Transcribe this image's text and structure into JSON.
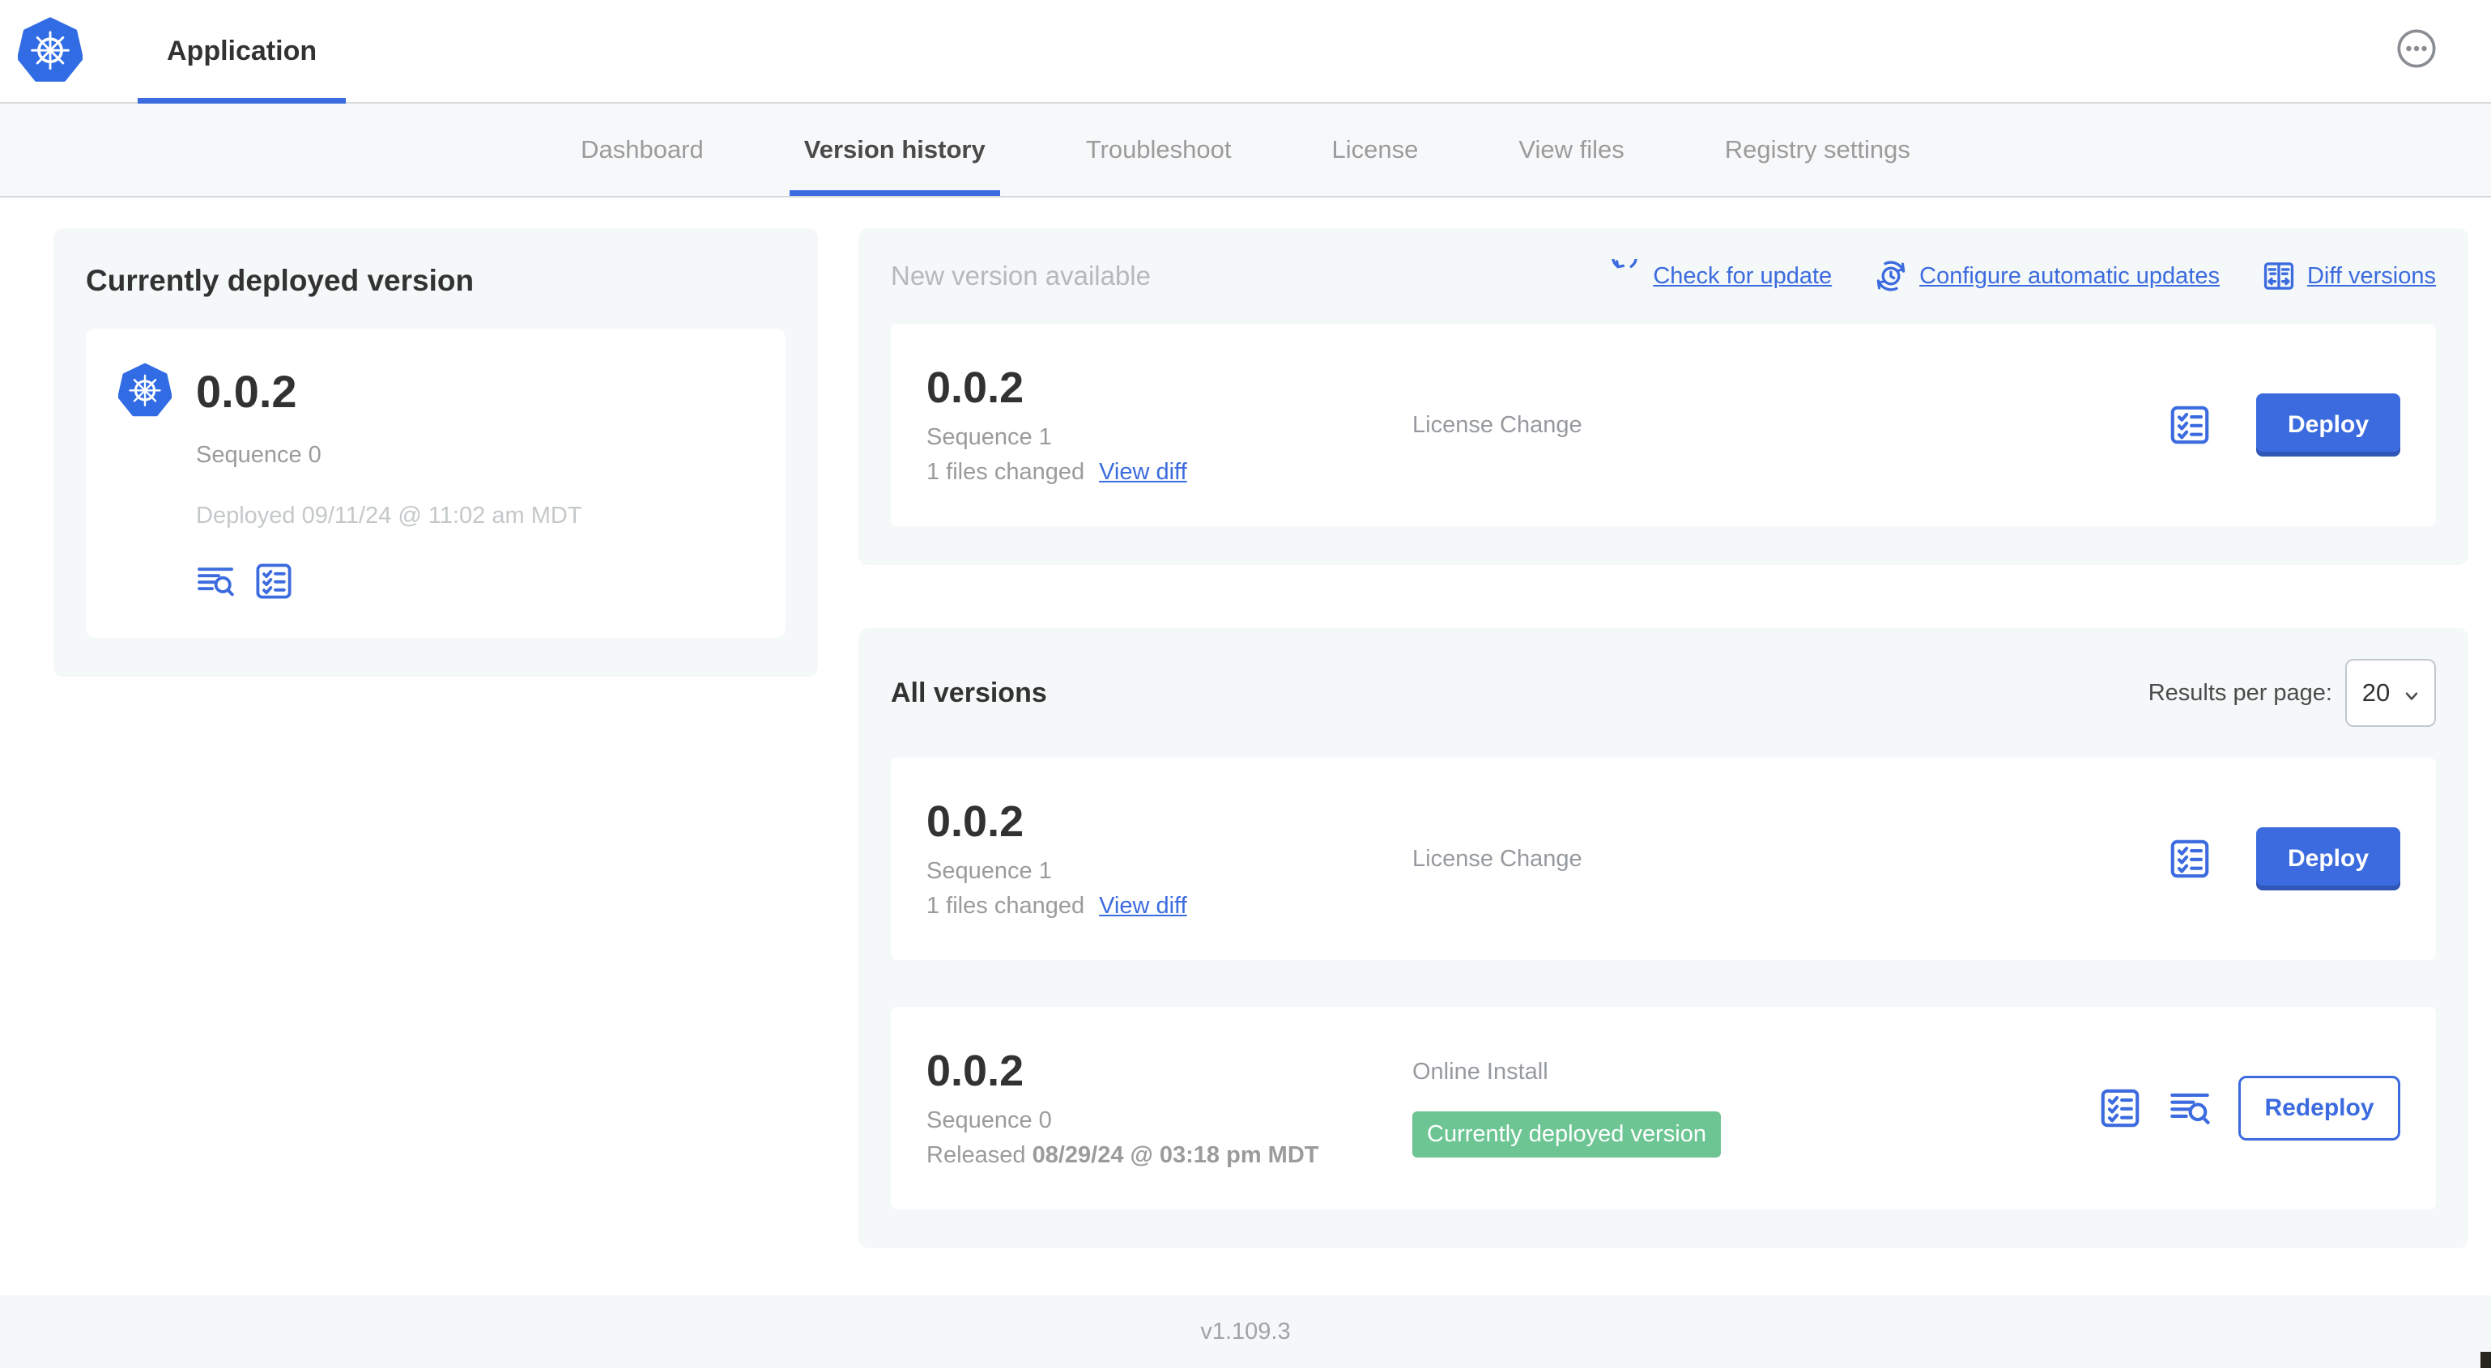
{
  "colors": {
    "accent_blue": "#3b6bde",
    "kubernetes_blue": "#326ce5",
    "badge_green": "#6dc594",
    "panel_gray": "#f5f8f9"
  },
  "header": {
    "app_title": "Application"
  },
  "nav": {
    "active_tab": "Version history",
    "tabs": [
      "Dashboard",
      "Version history",
      "Troubleshoot",
      "License",
      "View files",
      "Registry settings"
    ]
  },
  "deployed_card": {
    "title": "Currently deployed version",
    "version": "0.0.2",
    "sequence": "Sequence 0",
    "deployed_at": "Deployed 09/11/24 @ 11:02 am MDT"
  },
  "new_version_section": {
    "heading": "New version available",
    "check_for_update": "Check for update",
    "configure_automatic_updates": "Configure automatic updates",
    "diff_versions": "Diff versions"
  },
  "pending_version": {
    "version": "0.0.2",
    "sequence": "Sequence 1",
    "files_changed": "1 files changed",
    "view_diff": "View diff",
    "source": "License Change",
    "deploy_label": "Deploy"
  },
  "deployed_version": {
    "version": "0.0.2",
    "sequence": "Sequence 0",
    "released_prefix": "Released",
    "released_date": "08/29/24 @ 03:18 pm MDT",
    "source": "Online Install",
    "badge": "Currently deployed version",
    "redeploy_label": "Redeploy"
  },
  "all_versions_section": {
    "heading": "All versions",
    "results_per_page_label": "Results per page:",
    "results_per_page_value": "20"
  },
  "footer": {
    "version": "v1.109.3"
  },
  "icons": {
    "app_logo": "kubernetes-wheel",
    "menu": "ellipsis-in-circle",
    "check_for_update": "refresh-arrow",
    "configure_automatic_updates": "clock-sync-arrows",
    "diff_versions": "split-columns-arrows",
    "release_notes": "checklist-box",
    "logs": "text-lines-magnifier",
    "results_per_page": "chevron-down"
  }
}
